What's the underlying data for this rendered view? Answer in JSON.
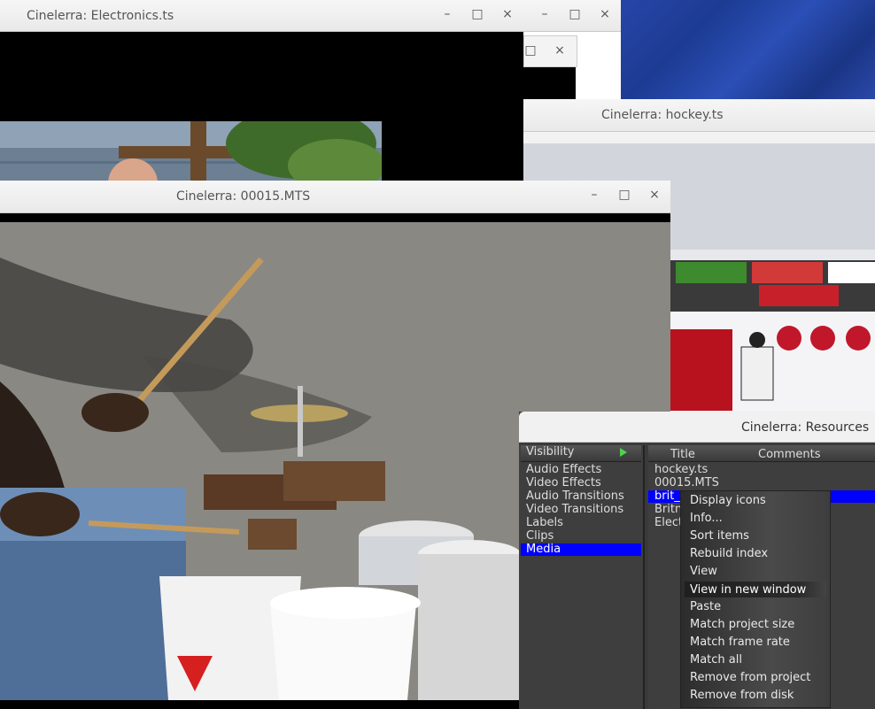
{
  "windows": {
    "electronics": {
      "title": "Cinelerra: Electronics.ts"
    },
    "hockey": {
      "title": "Cinelerra: hockey.ts"
    },
    "mts": {
      "title": "Cinelerra: 00015.MTS"
    },
    "resources": {
      "title": "Cinelerra: Resources"
    }
  },
  "controls": {
    "minimize": "–",
    "maximize": "□",
    "close": "×"
  },
  "resources": {
    "visibility_header": "Visibility",
    "folders": [
      "Audio Effects",
      "Video Effects",
      "Audio Transitions",
      "Video Transitions",
      "Labels",
      "Clips",
      "Media"
    ],
    "selected_folder": "Media",
    "columns": {
      "title": "Title",
      "comments": "Comments"
    },
    "media_items": [
      "hockey.ts",
      "00015.MTS",
      "brit_",
      "Britn",
      "Elect"
    ]
  },
  "context_menu": {
    "items": [
      "Display icons",
      "Info...",
      "Sort items",
      "Rebuild index",
      "View",
      "View in new window",
      "Paste",
      "Match project size",
      "Match frame rate",
      "Match all",
      "Remove from project",
      "Remove from disk"
    ],
    "highlighted": "View in new window"
  },
  "colors": {
    "selection": "#0000ff",
    "panel": "#3a3a3a",
    "menu_text": "#eaeaea"
  }
}
